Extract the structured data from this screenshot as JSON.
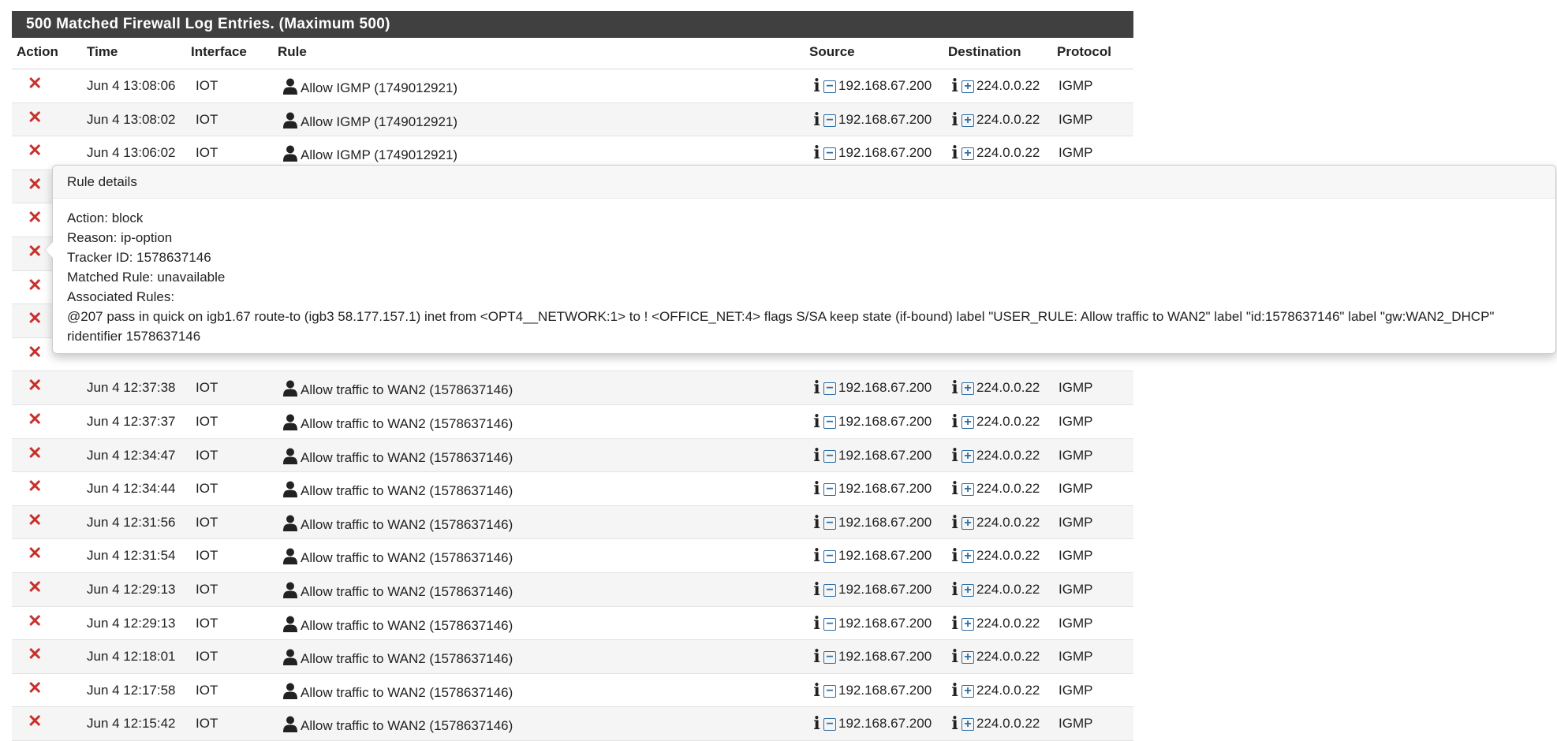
{
  "panel": {
    "title": "500 Matched Firewall Log Entries. (Maximum 500)"
  },
  "columns": [
    "Action",
    "Time",
    "Interface",
    "Rule",
    "Source",
    "Destination",
    "Protocol"
  ],
  "rows": [
    {
      "time": "Jun 4 13:08:06",
      "interface": "IOT",
      "rule": "Allow IGMP (1749012921)",
      "source": "192.168.67.200",
      "destination": "224.0.0.22",
      "protocol": "IGMP"
    },
    {
      "time": "Jun 4 13:08:02",
      "interface": "IOT",
      "rule": "Allow IGMP (1749012921)",
      "source": "192.168.67.200",
      "destination": "224.0.0.22",
      "protocol": "IGMP"
    },
    {
      "time": "Jun 4 13:06:02",
      "interface": "IOT",
      "rule": "Allow IGMP (1749012921)",
      "source": "192.168.67.200",
      "destination": "224.0.0.22",
      "protocol": "IGMP"
    },
    {
      "time": "",
      "interface": "",
      "rule": "",
      "source": "",
      "destination": "",
      "protocol": ""
    },
    {
      "time": "",
      "interface": "",
      "rule": "",
      "source": "",
      "destination": "",
      "protocol": ""
    },
    {
      "time": "",
      "interface": "",
      "rule": "",
      "source": "",
      "destination": "",
      "protocol": ""
    },
    {
      "time": "",
      "interface": "",
      "rule": "",
      "source": "",
      "destination": "",
      "protocol": ""
    },
    {
      "time": "",
      "interface": "",
      "rule": "",
      "source": "",
      "destination": "",
      "protocol": ""
    },
    {
      "time": "",
      "interface": "",
      "rule": "",
      "source": "",
      "destination": "",
      "protocol": ""
    },
    {
      "time": "Jun 4 12:37:38",
      "interface": "IOT",
      "rule": "Allow traffic to WAN2 (1578637146)",
      "source": "192.168.67.200",
      "destination": "224.0.0.22",
      "protocol": "IGMP"
    },
    {
      "time": "Jun 4 12:37:37",
      "interface": "IOT",
      "rule": "Allow traffic to WAN2 (1578637146)",
      "source": "192.168.67.200",
      "destination": "224.0.0.22",
      "protocol": "IGMP"
    },
    {
      "time": "Jun 4 12:34:47",
      "interface": "IOT",
      "rule": "Allow traffic to WAN2 (1578637146)",
      "source": "192.168.67.200",
      "destination": "224.0.0.22",
      "protocol": "IGMP"
    },
    {
      "time": "Jun 4 12:34:44",
      "interface": "IOT",
      "rule": "Allow traffic to WAN2 (1578637146)",
      "source": "192.168.67.200",
      "destination": "224.0.0.22",
      "protocol": "IGMP"
    },
    {
      "time": "Jun 4 12:31:56",
      "interface": "IOT",
      "rule": "Allow traffic to WAN2 (1578637146)",
      "source": "192.168.67.200",
      "destination": "224.0.0.22",
      "protocol": "IGMP"
    },
    {
      "time": "Jun 4 12:31:54",
      "interface": "IOT",
      "rule": "Allow traffic to WAN2 (1578637146)",
      "source": "192.168.67.200",
      "destination": "224.0.0.22",
      "protocol": "IGMP"
    },
    {
      "time": "Jun 4 12:29:13",
      "interface": "IOT",
      "rule": "Allow traffic to WAN2 (1578637146)",
      "source": "192.168.67.200",
      "destination": "224.0.0.22",
      "protocol": "IGMP"
    },
    {
      "time": "Jun 4 12:29:13",
      "interface": "IOT",
      "rule": "Allow traffic to WAN2 (1578637146)",
      "source": "192.168.67.200",
      "destination": "224.0.0.22",
      "protocol": "IGMP"
    },
    {
      "time": "Jun 4 12:18:01",
      "interface": "IOT",
      "rule": "Allow traffic to WAN2 (1578637146)",
      "source": "192.168.67.200",
      "destination": "224.0.0.22",
      "protocol": "IGMP"
    },
    {
      "time": "Jun 4 12:17:58",
      "interface": "IOT",
      "rule": "Allow traffic to WAN2 (1578637146)",
      "source": "192.168.67.200",
      "destination": "224.0.0.22",
      "protocol": "IGMP"
    },
    {
      "time": "Jun 4 12:15:42",
      "interface": "IOT",
      "rule": "Allow traffic to WAN2 (1578637146)",
      "source": "192.168.67.200",
      "destination": "224.0.0.22",
      "protocol": "IGMP"
    }
  ],
  "popover": {
    "title": "Rule details",
    "lines": [
      "Action: block",
      "Reason: ip-option",
      "Tracker ID: 1578637146",
      "Matched Rule: unavailable",
      "Associated Rules:",
      "@207 pass in quick on igb1.67 route-to (igb3 58.177.157.1) inet from <OPT4__NETWORK:1> to ! <OFFICE_NET:4> flags S/SA keep state (if-bound) label \"USER_RULE: Allow traffic to WAN2\" label \"id:1578637146\" label \"gw:WAN2_DHCP\"",
      "ridentifier 1578637146"
    ]
  },
  "icons": {
    "action": "block-x-icon",
    "rule": "user-icon",
    "info": "info-icon",
    "source_toggle": "minus-box-icon",
    "destination_toggle": "plus-box-icon"
  },
  "colors": {
    "header_bg": "#404040",
    "block_red": "#c9302c",
    "icon_blue": "#2e6da4"
  }
}
